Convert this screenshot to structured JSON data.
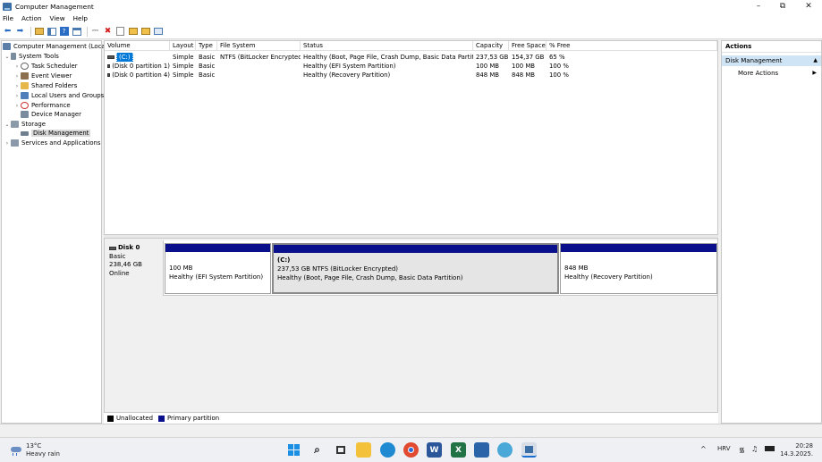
{
  "window": {
    "title": "Computer Management",
    "minimize": "–",
    "restore": "⧉",
    "close": "✕"
  },
  "menu": [
    "File",
    "Action",
    "View",
    "Help"
  ],
  "tree": {
    "root": "Computer Management (Local)",
    "system_tools": "System Tools",
    "task_scheduler": "Task Scheduler",
    "event_viewer": "Event Viewer",
    "shared_folders": "Shared Folders",
    "local_users": "Local Users and Groups",
    "performance": "Performance",
    "device_manager": "Device Manager",
    "storage": "Storage",
    "disk_management": "Disk Management",
    "services": "Services and Applications"
  },
  "volumes": {
    "headers": [
      "Volume",
      "Layout",
      "Type",
      "File System",
      "Status",
      "Capacity",
      "Free Space",
      "% Free"
    ],
    "rows": [
      [
        "(C:)",
        "Simple",
        "Basic",
        "NTFS (BitLocker Encrypted)",
        "Healthy (Boot, Page File, Crash Dump, Basic Data Partition)",
        "237,53 GB",
        "154,37 GB",
        "65 %"
      ],
      [
        "(Disk 0 partition 1)",
        "Simple",
        "Basic",
        "",
        "Healthy (EFI System Partition)",
        "100 MB",
        "100 MB",
        "100 %"
      ],
      [
        "(Disk 0 partition 4)",
        "Simple",
        "Basic",
        "",
        "Healthy (Recovery Partition)",
        "848 MB",
        "848 MB",
        "100 %"
      ]
    ]
  },
  "disk": {
    "name": "Disk 0",
    "type": "Basic",
    "size": "238,46 GB",
    "state": "Online",
    "partitions": [
      {
        "line1": "",
        "line2": "100 MB",
        "line3": "Healthy (EFI System Partition)"
      },
      {
        "line1": "(C:)",
        "line2": "237,53 GB NTFS (BitLocker Encrypted)",
        "line3": "Healthy (Boot, Page File, Crash Dump, Basic Data Partition)"
      },
      {
        "line1": "",
        "line2": "848 MB",
        "line3": "Healthy (Recovery Partition)"
      }
    ]
  },
  "legend": {
    "unallocated": "Unallocated",
    "primary": "Primary partition",
    "unallocated_color": "#000000",
    "primary_color": "#0a0f8c"
  },
  "actions": {
    "header": "Actions",
    "section": "Disk Management",
    "more": "More Actions"
  },
  "taskbar": {
    "temperature": "13°C",
    "weather": "Heavy rain",
    "language": "HRV",
    "time": "20:28",
    "date": "14.3.2025."
  }
}
